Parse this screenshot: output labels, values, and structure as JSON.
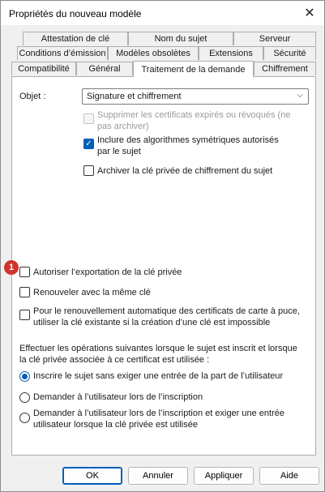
{
  "window": {
    "title": "Propriétés du nouveau modèle"
  },
  "tabs": {
    "row1": [
      "Attestation de clé",
      "Nom du sujet",
      "Serveur"
    ],
    "row2": [
      "Conditions d’émission",
      "Modèles obsolètes",
      "Extensions",
      "Sécurité"
    ],
    "row3": [
      "Compatibilité",
      "Général",
      "Traitement de la demande",
      "Chiffrement"
    ]
  },
  "purpose": {
    "label": "Objet :",
    "value": "Signature et chiffrement"
  },
  "options": {
    "delete_revoked": "Supprimer les certificats expirés ou révoqués (ne pas archiver)",
    "include_symmetric": "Inclure des algorithmes symétriques autorisés par le sujet",
    "archive_key": "Archiver la clé privée de chiffrement du sujet",
    "allow_export": "Autoriser l’exportation de la clé privée",
    "renew_same_key": "Renouveler avec la même clé",
    "smartcard_reuse": "Pour le renouvellement automatique des certificats de carte à puce, utiliser la clé existante si la création d’une clé est impossible"
  },
  "enrollment": {
    "intro": "Effectuer les opérations suivantes lorsque le sujet est inscrit et lorsque la clé privée associée à ce certificat est utilisée :",
    "radio1": "Inscrire le sujet sans exiger une entrée de la part de l’utilisateur",
    "radio2": "Demander à l’utilisateur lors de l’inscription",
    "radio3": "Demander à l’utilisateur lors de l’inscription et exiger une entrée utilisateur lorsque la clé privée est utilisée"
  },
  "annotation": {
    "badge": "1"
  },
  "buttons": {
    "ok": "OK",
    "cancel": "Annuler",
    "apply": "Appliquer",
    "help": "Aide"
  }
}
